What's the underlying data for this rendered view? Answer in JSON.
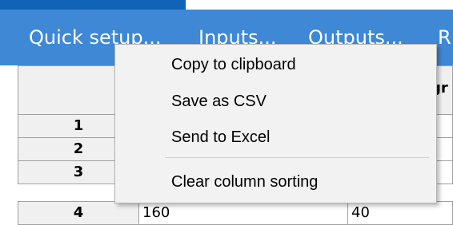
{
  "toolbar": {
    "items": [
      {
        "label": "Quick setup..."
      },
      {
        "label": "Inputs..."
      },
      {
        "label": "Outputs..."
      },
      {
        "label": "R"
      }
    ]
  },
  "table": {
    "column_header_fragment": "gr",
    "rows": [
      {
        "index": "1",
        "col1": "",
        "col2": ""
      },
      {
        "index": "2",
        "col1": "",
        "col2": ""
      },
      {
        "index": "3",
        "col1": "",
        "col2": ""
      },
      {
        "index": "4",
        "col1": "160",
        "col2": "40"
      }
    ]
  },
  "context_menu": {
    "items": [
      {
        "label": "Copy to clipboard"
      },
      {
        "label": "Save as CSV"
      },
      {
        "label": "Send to Excel"
      },
      {
        "label": "Clear column sorting"
      }
    ]
  },
  "colors": {
    "toolbar_bg": "#3e88d6",
    "toolbar_accent": "#0f64b8",
    "menu_bg": "#f2f2f2",
    "header_bg": "#f0f0f0",
    "grid_border": "#a0a0a0"
  }
}
